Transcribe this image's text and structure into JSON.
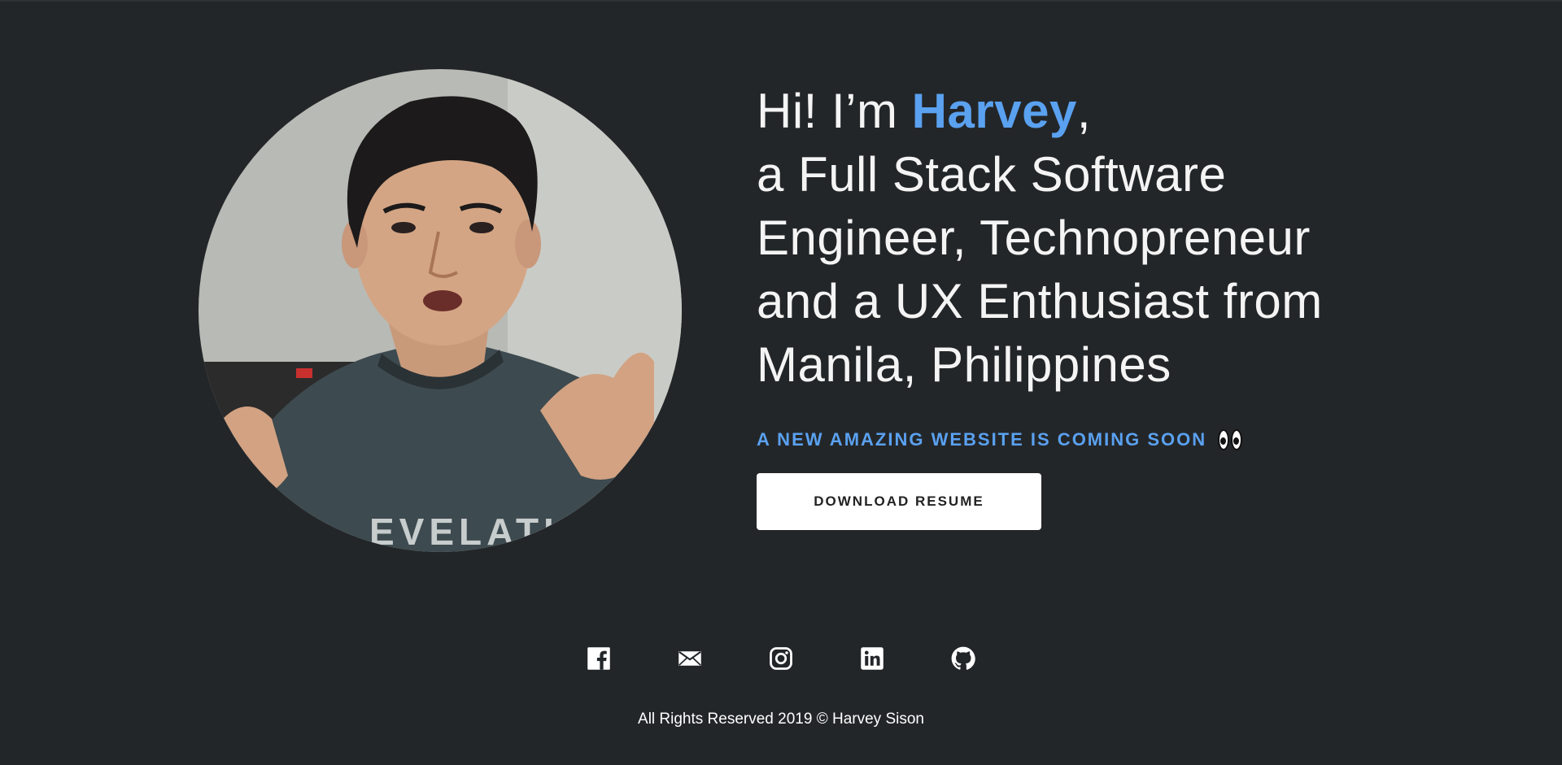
{
  "hero": {
    "greeting": "Hi! I’m ",
    "name": "Harvey",
    "comma": ",",
    "line2": "a Full Stack Software",
    "line3": "Engineer, Technopreneur",
    "line4": "and a UX Enthusiast from",
    "line5": "Manila, Philippines"
  },
  "announcement": {
    "text": "A NEW AMAZING WEBSITE IS COMING SOON",
    "icon": "eyes-icon"
  },
  "resume_button": {
    "label": "DOWNLOAD RESUME"
  },
  "social": [
    {
      "name": "facebook",
      "icon": "facebook-icon"
    },
    {
      "name": "email",
      "icon": "mail-icon"
    },
    {
      "name": "instagram",
      "icon": "instagram-icon"
    },
    {
      "name": "linkedin",
      "icon": "linkedin-icon"
    },
    {
      "name": "github",
      "icon": "github-icon"
    }
  ],
  "footer": {
    "text": "All Rights Reserved 2019 © Harvey Sison"
  },
  "colors": {
    "background": "#232629",
    "accent": "#5aa1f0",
    "text": "#ffffff"
  }
}
